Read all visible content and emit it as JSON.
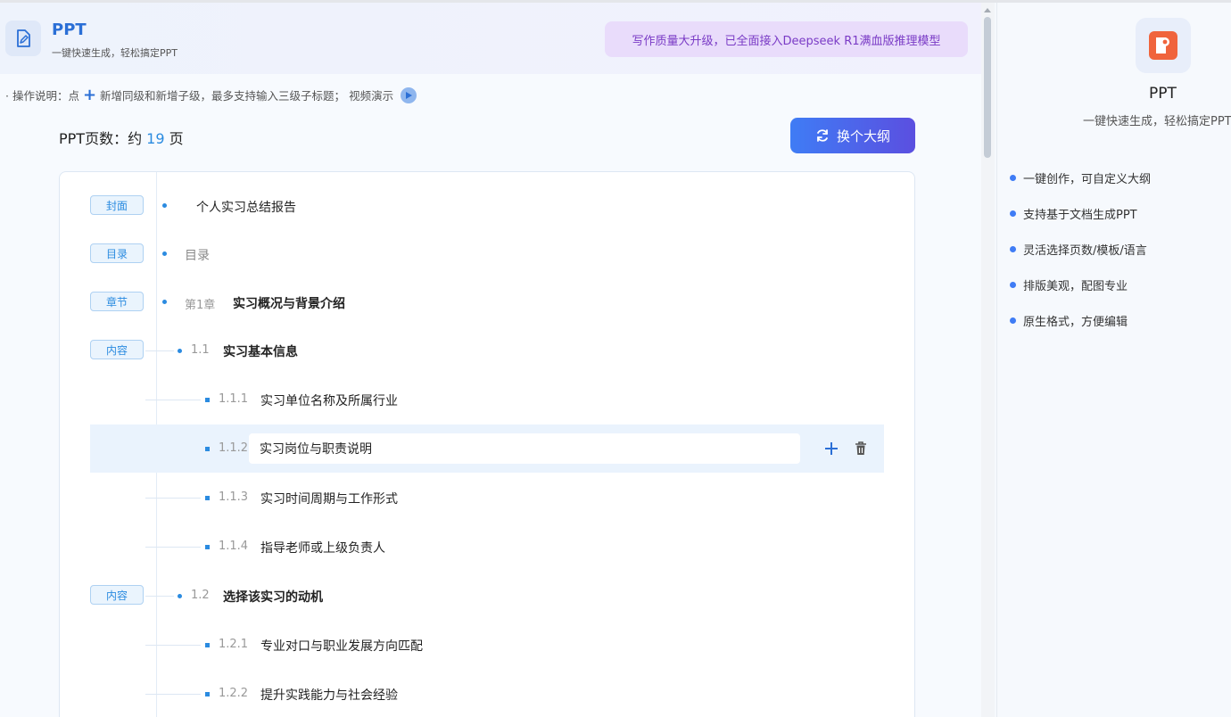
{
  "app": {
    "title": "PPT",
    "subtitle": "一键快速生成，轻松搞定PPT",
    "banner": "写作质量大升级，已全面接入Deepseek R1满血版推理模型"
  },
  "instructions": {
    "prefix": "· 操作说明：点",
    "suffix": "新增同级和新增子级，最多支持输入三级子标题；",
    "video_label": "视频演示"
  },
  "page_count": {
    "label": "PPT页数：约",
    "value": "19",
    "unit": "页"
  },
  "regen_button": {
    "label": "换个大纲"
  },
  "outline": {
    "rows": [
      {
        "tag": "封面",
        "number": "",
        "title": "个人实习总结报告"
      },
      {
        "tag": "目录",
        "number": "",
        "title": "目录"
      },
      {
        "tag": "章节",
        "number": "第1章",
        "title": "实习概况与背景介绍"
      },
      {
        "tag": "内容",
        "number": "1.1",
        "title": "实习基本信息"
      },
      {
        "tag": "",
        "number": "1.1.1",
        "title": "实习单位名称及所属行业"
      },
      {
        "tag": "",
        "number": "1.1.2",
        "title": "实习岗位与职责说明"
      },
      {
        "tag": "",
        "number": "1.1.3",
        "title": "实习时间周期与工作形式"
      },
      {
        "tag": "",
        "number": "1.1.4",
        "title": "指导老师或上级负责人"
      },
      {
        "tag": "内容",
        "number": "1.2",
        "title": "选择该实习的动机"
      },
      {
        "tag": "",
        "number": "1.2.1",
        "title": "专业对口与职业发展方向匹配"
      },
      {
        "tag": "",
        "number": "1.2.2",
        "title": "提升实践能力与社会经验"
      }
    ]
  },
  "sidebar": {
    "title": "PPT",
    "subtitle": "一键快速生成，轻松搞定PPT",
    "features": [
      "一键创作，可自定义大纲",
      "支持基于文档生成PPT",
      "灵活选择页数/模板/语言",
      "排版美观，配图专业",
      "原生格式，方便编辑"
    ]
  },
  "colors": {
    "accent": "#2b8be0",
    "button_gradient_start": "#3f7cf5",
    "button_gradient_end": "#5b4fe0",
    "banner_bg": "#e9dcfb",
    "banner_text": "#7a3bc6"
  }
}
